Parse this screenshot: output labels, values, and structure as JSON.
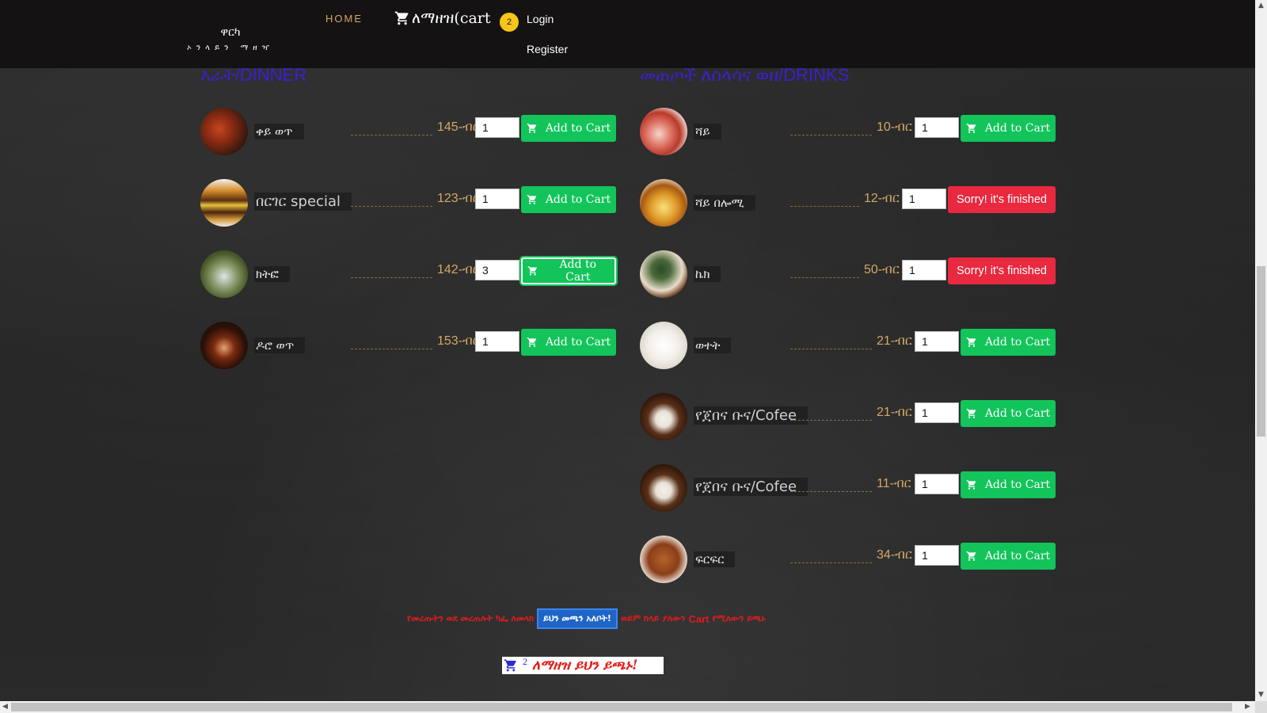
{
  "nav": {
    "brand_name": "ዋርካ",
    "brand_sub": "ኦንላይን ማዘዣ",
    "home": "HOME",
    "cart_label": "ለማዘዝ(cart",
    "cart_count": "2",
    "login": "Login",
    "register": "Register"
  },
  "dinner": {
    "title": "እራት/DINNER",
    "items": [
      {
        "name": "ቀይ ወጥ",
        "price": "145-ብር",
        "qty": "1",
        "button": "Add to Cart",
        "status": "available",
        "icon": "red-stew-dish"
      },
      {
        "name": "በርገር special",
        "price": "123-ብር",
        "qty": "1",
        "button": "Add to Cart",
        "status": "available",
        "icon": "burger"
      },
      {
        "name": "ክትፎ",
        "price": "142-ብር",
        "qty": "3",
        "button": "Add to Cart",
        "status": "available",
        "icon": "kitfo-dish"
      },
      {
        "name": "ዶሮ ወጥ",
        "price": "153-ብር",
        "qty": "1",
        "button": "Add to Cart",
        "status": "available",
        "icon": "doro-wat-dish"
      }
    ]
  },
  "drinks": {
    "title": "መጠጦች ለስላሳና ወዘ/DRINKS",
    "items": [
      {
        "name": "ሻይ",
        "price": "10-ብር",
        "qty": "1",
        "button": "Add to Cart",
        "status": "available",
        "icon": "tea-cups"
      },
      {
        "name": "ሻይ በሎሚ",
        "price": "12-ብር",
        "qty": "1",
        "button": "Sorry! it's finished",
        "status": "finished",
        "icon": "lemon-tea"
      },
      {
        "name": "ኬክ",
        "price": "50-ብር",
        "qty": "1",
        "button": "Sorry! it's finished",
        "status": "finished",
        "icon": "cake"
      },
      {
        "name": "ወተት",
        "price": "21-ብር",
        "qty": "1",
        "button": "Add to Cart",
        "status": "available",
        "icon": "milk"
      },
      {
        "name": "የጀበና ቡና/Cofee",
        "price": "21-ብር",
        "qty": "1",
        "button": "Add to Cart",
        "status": "available",
        "icon": "coffee-beans"
      },
      {
        "name": "የጀበና ቡና/Cofee",
        "price": "11-ብር",
        "qty": "1",
        "button": "Add to Cart",
        "status": "available",
        "icon": "coffee-beans"
      },
      {
        "name": "ፍርፍር",
        "price": "34-ብር",
        "qty": "1",
        "button": "Add to Cart",
        "status": "available",
        "icon": "firfir-dish"
      }
    ]
  },
  "notice": {
    "before": "የመረጡትን ወደ መረጠሉት ካፌ ለመላክ",
    "button": "ይህን መጫን አለቦት!",
    "after_1": "ወይም ከላይ ያለውን",
    "after_cart": "Cart",
    "after_2": "የሚለውን ይጫኑ"
  },
  "order": {
    "count": "2",
    "label": "ለማዘዝ ይህን ይጫኑ!"
  },
  "colors": {
    "accent_gold": "#d3a866",
    "add_green": "#12c45a",
    "sorry_red": "#e8293f",
    "title_blue": "#3b1fd6"
  }
}
